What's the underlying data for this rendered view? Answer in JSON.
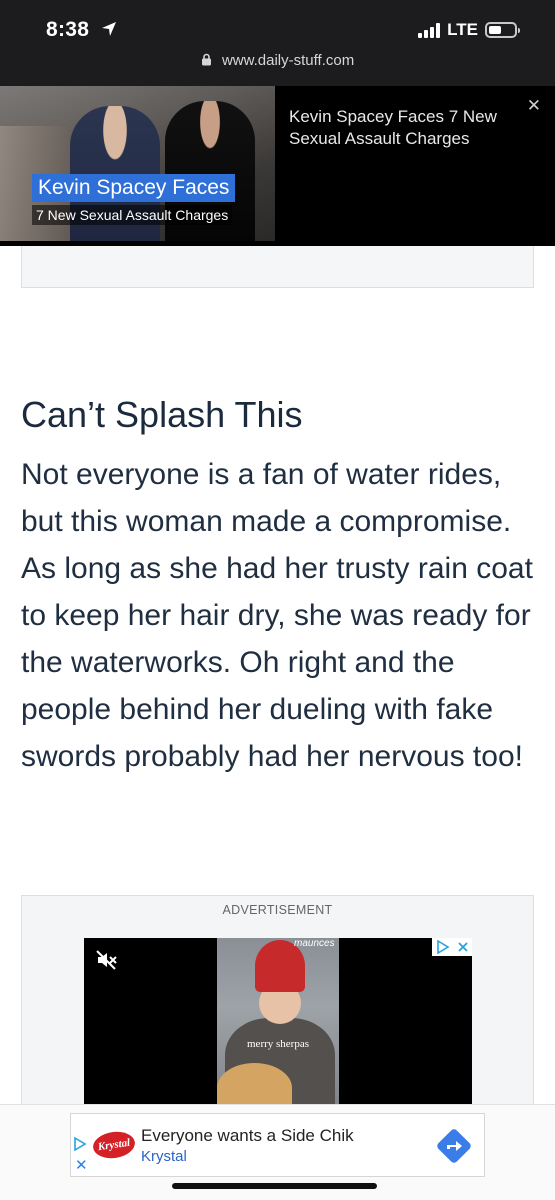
{
  "status_bar": {
    "time": "8:38",
    "network": "LTE",
    "url": "www.daily-stuff.com"
  },
  "video_banner": {
    "caption_line1": "Kevin Spacey Faces",
    "caption_line2": "7 New Sexual Assault Charges",
    "title": "Kevin Spacey Faces 7 New Sexual Assault Charges",
    "close_label": "✕"
  },
  "article": {
    "heading": "Can’t Splash This",
    "body": "Not everyone is a fan of water rides, but this woman made a compromise. As long as she had her trusty rain coat to keep her hair dry, she was ready for the waterworks. Oh right and the people behind her dueling with fake swords probably had her nervous too!"
  },
  "advertisement": {
    "label": "ADVERTISEMENT",
    "brand_watermark": "maunces",
    "overlay_text": "merry sherpas"
  },
  "sticky_ad": {
    "logo_text": "Krystal",
    "title": "Everyone wants a Side Chik",
    "advertiser": "Krystal",
    "close_label": "✕"
  },
  "colors": {
    "heading": "#1b2a3d",
    "body_text": "#1f2e40",
    "caption_blue": "#2f6fd8",
    "link_blue": "#2b64c8",
    "krystal_red": "#d42027"
  }
}
